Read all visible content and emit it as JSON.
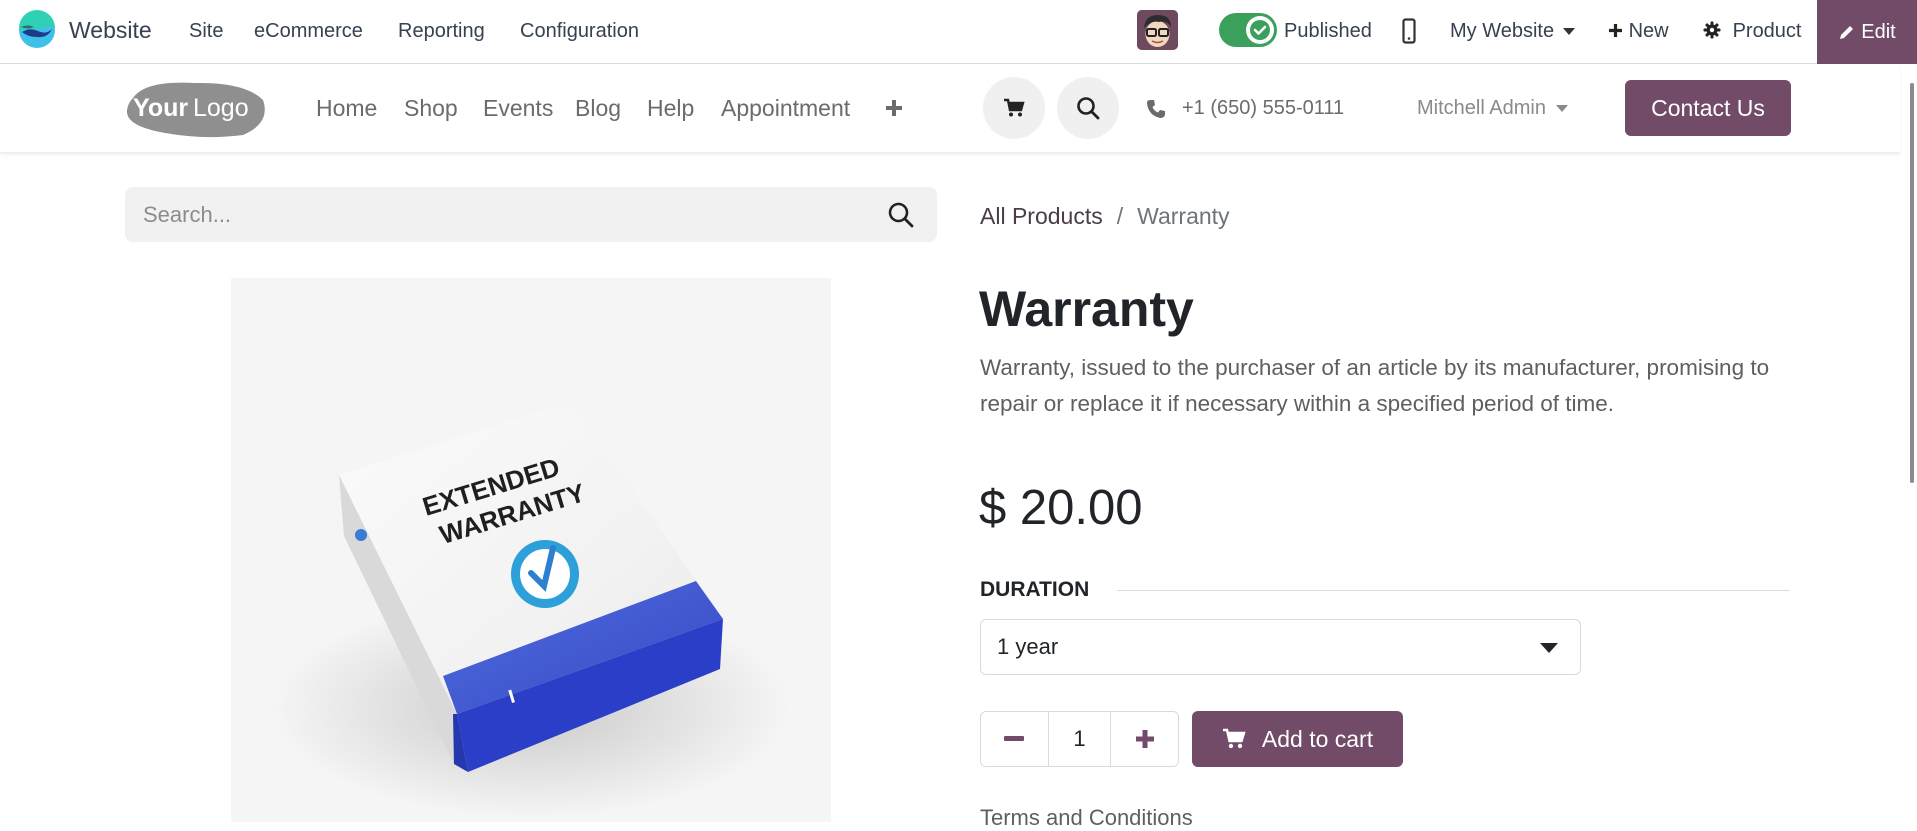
{
  "topbar": {
    "app_name": "Website",
    "menus": [
      "Site",
      "eCommerce",
      "Reporting",
      "Configuration"
    ],
    "published_label": "Published",
    "published": true,
    "website_selector": "My Website",
    "new_label": "New",
    "product_label": "Product",
    "edit_label": "Edit"
  },
  "site_header": {
    "logo_text_bold": "Your",
    "logo_text_light": "Logo",
    "nav": [
      "Home",
      "Shop",
      "Events",
      "Blog",
      "Help",
      "Appointment"
    ],
    "phone": "+1 (650) 555-0111",
    "user": "Mitchell Admin",
    "contact_label": "Contact Us"
  },
  "search": {
    "placeholder": "Search...",
    "value": ""
  },
  "breadcrumb": {
    "parent": "All Products",
    "separator": "/",
    "current": "Warranty"
  },
  "product": {
    "name": "Warranty",
    "description": "Warranty, issued to the purchaser of an article by its manufacturer, promising to repair or replace it if necessary within a specified period of time.",
    "price": "$ 20.00",
    "image_text_line1": "EXTENDED",
    "image_text_line2": "WARRANTY",
    "attribute_label": "DURATION",
    "attribute_value": "1 year",
    "quantity": "1",
    "add_to_cart_label": "Add to cart",
    "terms_label": "Terms and Conditions"
  },
  "colors": {
    "brand": "#714b67",
    "published_green": "#3aa05c",
    "box_blue": "#3a55d6"
  }
}
